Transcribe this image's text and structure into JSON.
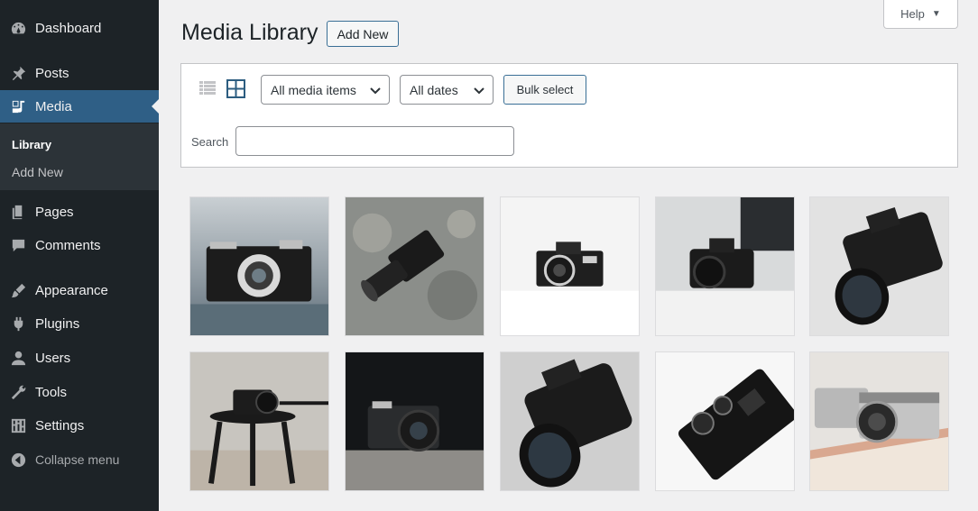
{
  "sidebar": {
    "items": [
      {
        "label": "Dashboard",
        "icon": "dashboard-icon"
      },
      {
        "label": "Posts",
        "icon": "pin-icon"
      },
      {
        "label": "Media",
        "icon": "media-icon"
      },
      {
        "label": "Pages",
        "icon": "pages-icon"
      },
      {
        "label": "Comments",
        "icon": "comments-icon"
      },
      {
        "label": "Appearance",
        "icon": "brush-icon"
      },
      {
        "label": "Plugins",
        "icon": "plugin-icon"
      },
      {
        "label": "Users",
        "icon": "user-icon"
      },
      {
        "label": "Tools",
        "icon": "wrench-icon"
      },
      {
        "label": "Settings",
        "icon": "settings-icon"
      }
    ],
    "submenu": [
      {
        "label": "Library"
      },
      {
        "label": "Add New"
      }
    ],
    "collapse_label": "Collapse menu"
  },
  "header": {
    "title": "Media Library",
    "add_new_label": "Add New",
    "help_label": "Help"
  },
  "toolbar": {
    "filter_type": "All media items",
    "filter_date": "All dates",
    "bulk_select_label": "Bulk select",
    "search_label": "Search",
    "search_value": ""
  },
  "grid": {
    "items": [
      {
        "subject": "vintage rangefinder camera"
      },
      {
        "subject": "mirrorless camera with zoom lens"
      },
      {
        "subject": "film SLR camera on white"
      },
      {
        "subject": "DSLR camera on white table"
      },
      {
        "subject": "DSLR camera angled"
      },
      {
        "subject": "camera on stool"
      },
      {
        "subject": "camera in dark"
      },
      {
        "subject": "Canon DSLR camera"
      },
      {
        "subject": "camera top dials"
      },
      {
        "subject": "Fujifilm cameras on box"
      }
    ]
  },
  "colors": {
    "sidebar_bg": "#1d2327",
    "active_bg": "#2f5f86",
    "accent": "#3a6f96"
  }
}
